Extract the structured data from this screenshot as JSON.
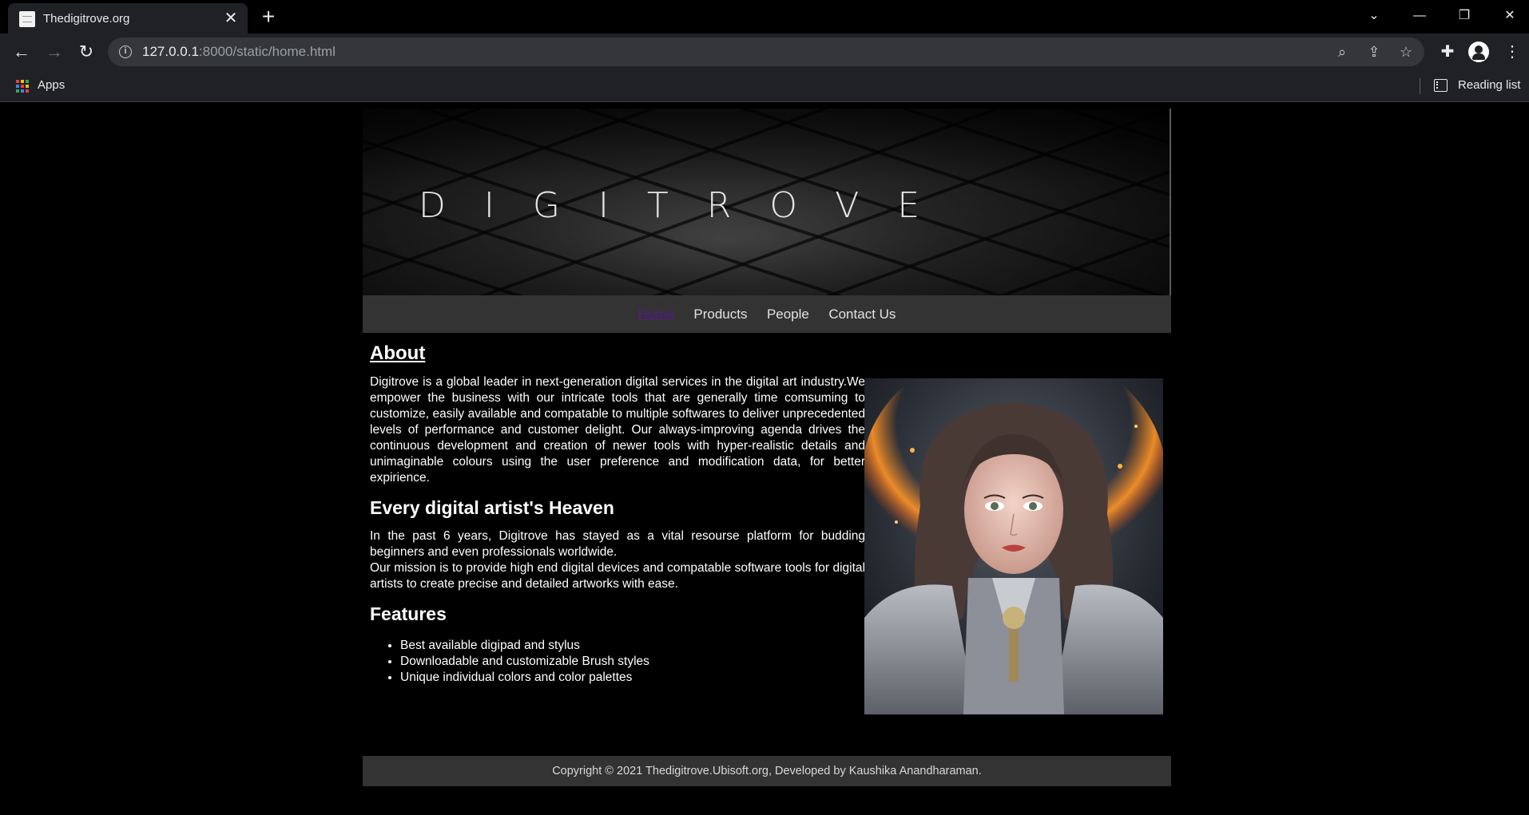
{
  "browser": {
    "tab_title": "Thedigitrove.org",
    "url_host": "127.0.0.1",
    "url_rest": ":8000/static/home.html",
    "bookmarks": {
      "apps_label": "Apps",
      "reading_list_label": "Reading list"
    }
  },
  "site": {
    "banner_title": "DIGITROVE",
    "nav": [
      {
        "label": "Home",
        "active": true
      },
      {
        "label": "Products",
        "active": false
      },
      {
        "label": "People",
        "active": false
      },
      {
        "label": "Contact Us",
        "active": false
      }
    ],
    "about": {
      "heading": "About",
      "text": "Digitrove is a global leader in next-generation digital services in the digital art industry.We empower the business with our intricate tools that are generally time comsuming to customize, easily available and compatable to multiple softwares to deliver unprecedented levels of performance and customer delight. Our always-improving agenda drives the continuous development and creation of newer tools with hyper-realistic details and unimaginable colours using the user preference and modification data, for better expirience."
    },
    "heaven": {
      "heading": "Every digital artist's Heaven",
      "text1": "In the past 6 years, Digitrove has stayed as a vital resourse platform for budding beginners and even professionals worldwide.",
      "text2": "Our mission is to provide high end digital devices and compatable software tools for digital artists to create precise and detailed artworks with ease."
    },
    "features": {
      "heading": "Features",
      "items": [
        "Best available digipad and stylus",
        "Downloadable and customizable Brush styles",
        "Unique individual colors and color palettes"
      ]
    },
    "footer": "Copyright © 2021 Thedigitrove.Ubisoft.org, Developed by Kaushika Anandharaman."
  }
}
